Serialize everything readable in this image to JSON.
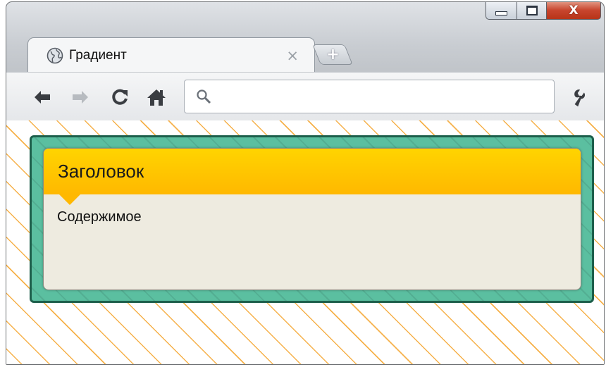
{
  "window": {
    "controls": {
      "minimize_icon": "minimize-icon",
      "maximize_icon": "maximize-icon",
      "close_label": "X"
    }
  },
  "tab": {
    "title": "Градиент",
    "favicon": "globe-icon",
    "close_label": "×",
    "new_tab_label": "+"
  },
  "toolbar": {
    "back_icon": "back-arrow-icon",
    "forward_icon": "forward-arrow-icon",
    "reload_icon": "reload-icon",
    "home_icon": "home-icon",
    "omnibox_icon": "search-icon",
    "omnibox_value": "",
    "settings_icon": "wrench-icon"
  },
  "page": {
    "card": {
      "title": "Заголовок",
      "content": "Содержимое"
    },
    "colors": {
      "frame": "#5bbfa0",
      "frame_border": "#1d5f4b",
      "header": "#ffc800",
      "card_body": "#eeebe0",
      "stripes": "#f6b14a"
    }
  }
}
